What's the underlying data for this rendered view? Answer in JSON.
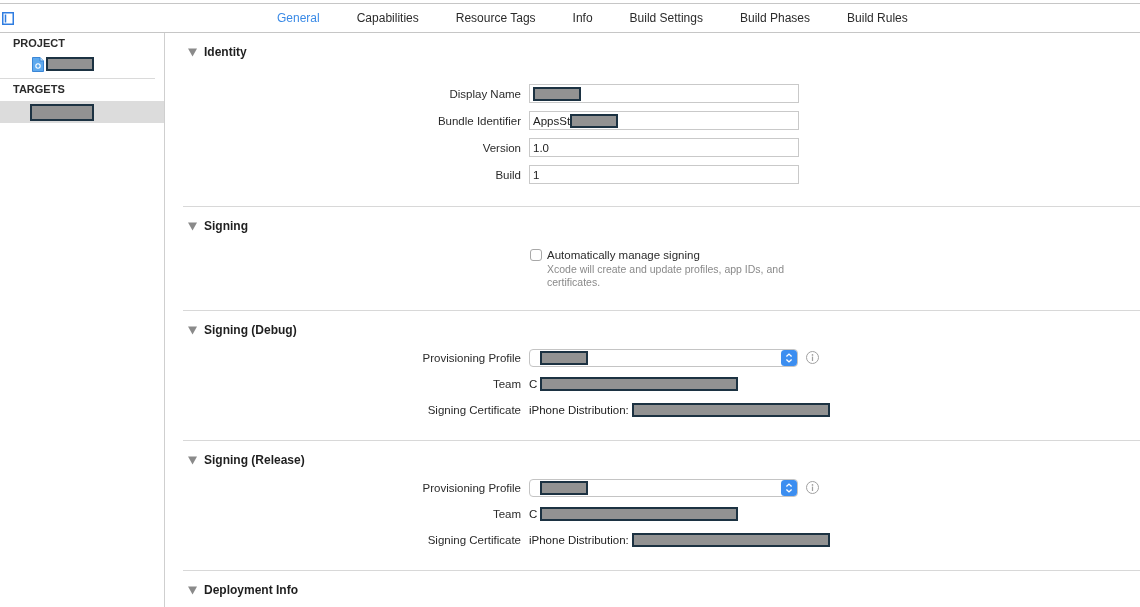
{
  "toolbar": {
    "tabs": [
      {
        "label": "General",
        "selected": true
      },
      {
        "label": "Capabilities",
        "selected": false
      },
      {
        "label": "Resource Tags",
        "selected": false
      },
      {
        "label": "Info",
        "selected": false
      },
      {
        "label": "Build Settings",
        "selected": false
      },
      {
        "label": "Build Phases",
        "selected": false
      },
      {
        "label": "Build Rules",
        "selected": false
      }
    ]
  },
  "sidebar": {
    "groups": [
      {
        "heading": "PROJECT",
        "items": [
          {
            "kind": "project",
            "selected": false,
            "redacted": true
          }
        ]
      },
      {
        "heading": "TARGETS",
        "items": [
          {
            "kind": "target",
            "selected": true,
            "redacted": true
          }
        ]
      }
    ]
  },
  "sections": [
    {
      "title": "Identity",
      "expanded": true,
      "rows": [
        {
          "kind": "text_field",
          "label": "Display Name",
          "redacted": true
        },
        {
          "kind": "text_field",
          "label": "Bundle Identifier",
          "value": "AppsSt",
          "redacted": true
        },
        {
          "kind": "text_field",
          "label": "Version",
          "value": "1.0"
        },
        {
          "kind": "text_field",
          "label": "Build",
          "value": "1"
        }
      ]
    },
    {
      "title": "Signing",
      "expanded": true,
      "rows": [
        {
          "kind": "checkbox",
          "label": "Automatically manage signing",
          "checked": false,
          "description": "Xcode will create and update profiles, app IDs, and certificates."
        }
      ]
    },
    {
      "title": "Signing (Debug)",
      "expanded": true,
      "rows": [
        {
          "kind": "popup",
          "label": "Provisioning Profile",
          "redacted": true,
          "info": true
        },
        {
          "kind": "text",
          "label": "Team",
          "value": "C",
          "redacted": true
        },
        {
          "kind": "text",
          "label": "Signing Certificate",
          "value": "iPhone Distribution:",
          "redacted": true
        }
      ]
    },
    {
      "title": "Signing (Release)",
      "expanded": true,
      "rows": [
        {
          "kind": "popup",
          "label": "Provisioning Profile",
          "redacted": true,
          "info": true
        },
        {
          "kind": "text",
          "label": "Team",
          "value": "C",
          "redacted": true
        },
        {
          "kind": "text",
          "label": "Signing Certificate",
          "value": "iPhone Distribution:",
          "redacted": true
        }
      ]
    },
    {
      "title": "Deployment Info",
      "expanded": true
    }
  ]
}
